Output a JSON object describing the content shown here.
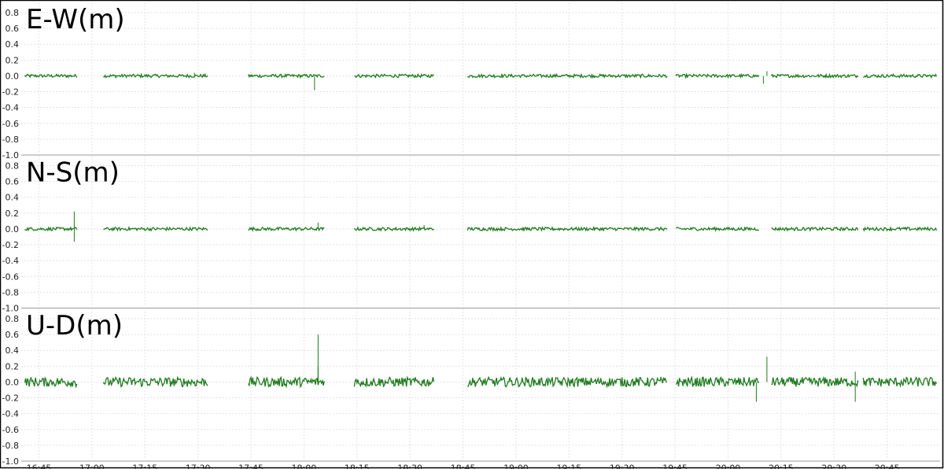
{
  "chart_data": {
    "type": "line",
    "x_ticks": [
      "16:45",
      "17:00",
      "17:15",
      "17:30",
      "17:45",
      "18:00",
      "18:15",
      "18:30",
      "18:45",
      "19:00",
      "19:15",
      "19:30",
      "19:45",
      "20:00",
      "20:15",
      "20:30",
      "20:45"
    ],
    "y_ticks": [
      "0.8",
      "0.6",
      "0.4",
      "0.2",
      "0.0",
      "-0.2",
      "-0.4",
      "-0.6",
      "-0.8",
      "-1.0"
    ],
    "ylim": [
      -1.0,
      1.0
    ],
    "x_range": [
      "16:40",
      "21:00"
    ],
    "grid": true,
    "line_color": "#1e7a1e",
    "gaps": [
      [
        "16:56",
        "17:03"
      ],
      [
        "17:33",
        "17:44"
      ],
      [
        "18:06",
        "18:14"
      ],
      [
        "18:37",
        "18:46"
      ],
      [
        "19:43",
        "19:45"
      ],
      [
        "20:09",
        "20:12"
      ],
      [
        "20:37",
        "20:38"
      ]
    ],
    "panels": [
      {
        "title": "E-W(m)",
        "level": 0.0,
        "noise": 0.02,
        "spikes": [
          [
            "17:29",
            0.04
          ],
          [
            "18:03",
            -0.18
          ],
          [
            "20:11",
            0.06
          ],
          [
            "20:10",
            -0.1
          ]
        ]
      },
      {
        "title": "N-S(m)",
        "level": 0.0,
        "noise": 0.02,
        "spikes": [
          [
            "16:55",
            0.22
          ],
          [
            "16:55",
            -0.16
          ],
          [
            "18:04",
            0.08
          ],
          [
            "18:34",
            0.05
          ]
        ]
      },
      {
        "title": "U-D(m)",
        "level": 0.0,
        "noise": 0.06,
        "spikes": [
          [
            "18:04",
            0.6
          ],
          [
            "18:04",
            0.2
          ],
          [
            "20:11",
            0.32
          ],
          [
            "20:08",
            -0.25
          ],
          [
            "20:36",
            -0.25
          ],
          [
            "20:36",
            0.13
          ]
        ]
      }
    ]
  }
}
